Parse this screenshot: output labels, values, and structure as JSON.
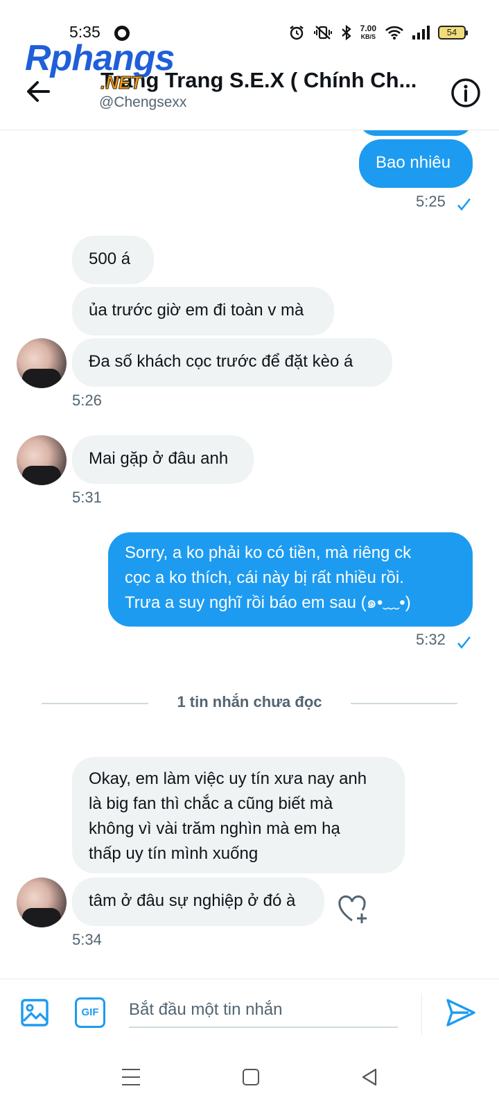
{
  "status_bar": {
    "time": "5:35",
    "net_speed_value": "7.00",
    "net_speed_unit": "KB/S",
    "battery": "54"
  },
  "watermark": {
    "main": "Rphangs",
    "suffix": ".NET"
  },
  "header": {
    "title": "Trang Trang S.E.X ( Chính Ch...",
    "handle": "@Chengsexx"
  },
  "messages": {
    "m1": {
      "text": "Bao nhiêu",
      "time": "5:25"
    },
    "m2": {
      "text": "500 á"
    },
    "m3": {
      "text": "ủa trước giờ em đi toàn v mà"
    },
    "m4": {
      "text": "Đa số khách cọc trước để đặt kèo á",
      "time": "5:26"
    },
    "m5": {
      "text": "Mai gặp ở đâu anh",
      "time": "5:31"
    },
    "m6": {
      "line1": "Sorry, a ko phải ko có tiền, mà riêng ck",
      "line2": "cọc a ko thích, cái này bị rất nhiều rồi.",
      "line3": "Trưa a suy nghĩ rồi báo em sau (๑•﹏•)",
      "time": "5:32"
    },
    "m7": {
      "line1": "Okay, em làm việc uy tín xưa nay anh",
      "line2": "là big fan thì chắc a cũng biết mà",
      "line3": "không vì vài trăm nghìn mà em hạ",
      "line4": "thấp uy tín mình xuống"
    },
    "m8": {
      "text": "tâm ở đâu sự nghiệp ở đó à",
      "time": "5:34"
    }
  },
  "divider": {
    "label": "1 tin nhắn chưa đọc"
  },
  "composer": {
    "gif_label": "GIF",
    "placeholder": "Bắt đầu một tin nhắn"
  },
  "colors": {
    "accent": "#1d9bf0",
    "incoming_bubble": "#eff3f4",
    "secondary_text": "#536471"
  }
}
